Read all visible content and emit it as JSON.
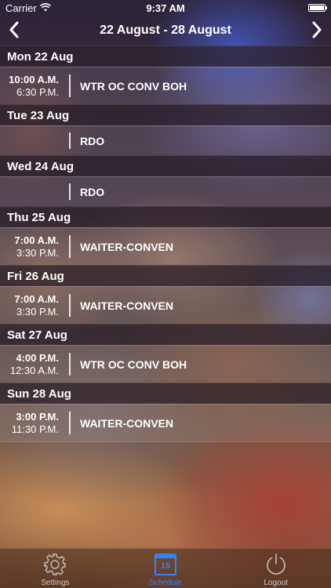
{
  "status_bar": {
    "carrier": "Carrier",
    "time": "9:37 AM"
  },
  "header": {
    "title": "22 August - 28 August"
  },
  "days": [
    {
      "label": "Mon 22 Aug",
      "shift": {
        "start": "10:00 A.M.",
        "end": "6:30 P.M.",
        "name": "WTR OC CONV BOH"
      }
    },
    {
      "label": "Tue 23 Aug",
      "shift": {
        "start": "",
        "end": "",
        "name": "RDO"
      }
    },
    {
      "label": "Wed 24 Aug",
      "shift": {
        "start": "",
        "end": "",
        "name": "RDO"
      }
    },
    {
      "label": "Thu 25 Aug",
      "shift": {
        "start": "7:00 A.M.",
        "end": "3:30 P.M.",
        "name": "WAITER-CONVEN"
      }
    },
    {
      "label": "Fri 26 Aug",
      "shift": {
        "start": "7:00 A.M.",
        "end": "3:30 P.M.",
        "name": "WAITER-CONVEN"
      }
    },
    {
      "label": "Sat 27 Aug",
      "shift": {
        "start": "4:00 P.M.",
        "end": "12:30 A.M.",
        "name": "WTR OC CONV BOH"
      }
    },
    {
      "label": "Sun 28 Aug",
      "shift": {
        "start": "3:00 P.M.",
        "end": "11:30 P.M.",
        "name": "WAITER-CONVEN"
      }
    }
  ],
  "tab_bar": {
    "tabs": [
      {
        "label": "Settings",
        "icon": "gear-icon"
      },
      {
        "label": "Schedule",
        "icon": "calendar-icon",
        "calendar_day": "15",
        "active": true
      },
      {
        "label": "Logout",
        "icon": "power-icon"
      }
    ]
  },
  "colors": {
    "accent": "#2e86ff"
  }
}
